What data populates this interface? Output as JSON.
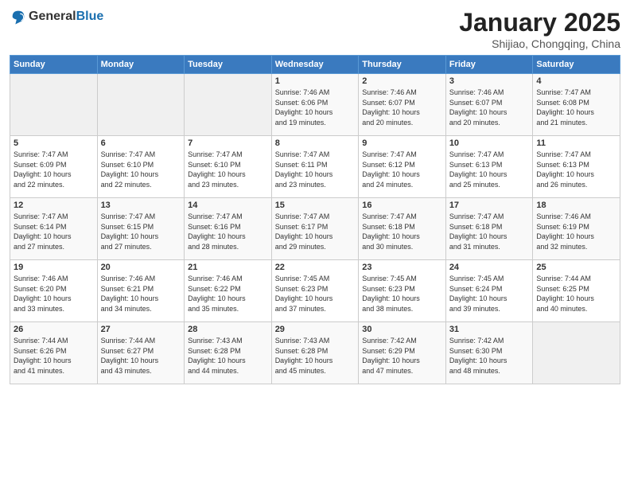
{
  "logo": {
    "general": "General",
    "blue": "Blue"
  },
  "header": {
    "title": "January 2025",
    "subtitle": "Shijiao, Chongqing, China"
  },
  "weekdays": [
    "Sunday",
    "Monday",
    "Tuesday",
    "Wednesday",
    "Thursday",
    "Friday",
    "Saturday"
  ],
  "weeks": [
    [
      {
        "day": "",
        "info": ""
      },
      {
        "day": "",
        "info": ""
      },
      {
        "day": "",
        "info": ""
      },
      {
        "day": "1",
        "info": "Sunrise: 7:46 AM\nSunset: 6:06 PM\nDaylight: 10 hours\nand 19 minutes."
      },
      {
        "day": "2",
        "info": "Sunrise: 7:46 AM\nSunset: 6:07 PM\nDaylight: 10 hours\nand 20 minutes."
      },
      {
        "day": "3",
        "info": "Sunrise: 7:46 AM\nSunset: 6:07 PM\nDaylight: 10 hours\nand 20 minutes."
      },
      {
        "day": "4",
        "info": "Sunrise: 7:47 AM\nSunset: 6:08 PM\nDaylight: 10 hours\nand 21 minutes."
      }
    ],
    [
      {
        "day": "5",
        "info": "Sunrise: 7:47 AM\nSunset: 6:09 PM\nDaylight: 10 hours\nand 22 minutes."
      },
      {
        "day": "6",
        "info": "Sunrise: 7:47 AM\nSunset: 6:10 PM\nDaylight: 10 hours\nand 22 minutes."
      },
      {
        "day": "7",
        "info": "Sunrise: 7:47 AM\nSunset: 6:10 PM\nDaylight: 10 hours\nand 23 minutes."
      },
      {
        "day": "8",
        "info": "Sunrise: 7:47 AM\nSunset: 6:11 PM\nDaylight: 10 hours\nand 23 minutes."
      },
      {
        "day": "9",
        "info": "Sunrise: 7:47 AM\nSunset: 6:12 PM\nDaylight: 10 hours\nand 24 minutes."
      },
      {
        "day": "10",
        "info": "Sunrise: 7:47 AM\nSunset: 6:13 PM\nDaylight: 10 hours\nand 25 minutes."
      },
      {
        "day": "11",
        "info": "Sunrise: 7:47 AM\nSunset: 6:13 PM\nDaylight: 10 hours\nand 26 minutes."
      }
    ],
    [
      {
        "day": "12",
        "info": "Sunrise: 7:47 AM\nSunset: 6:14 PM\nDaylight: 10 hours\nand 27 minutes."
      },
      {
        "day": "13",
        "info": "Sunrise: 7:47 AM\nSunset: 6:15 PM\nDaylight: 10 hours\nand 27 minutes."
      },
      {
        "day": "14",
        "info": "Sunrise: 7:47 AM\nSunset: 6:16 PM\nDaylight: 10 hours\nand 28 minutes."
      },
      {
        "day": "15",
        "info": "Sunrise: 7:47 AM\nSunset: 6:17 PM\nDaylight: 10 hours\nand 29 minutes."
      },
      {
        "day": "16",
        "info": "Sunrise: 7:47 AM\nSunset: 6:18 PM\nDaylight: 10 hours\nand 30 minutes."
      },
      {
        "day": "17",
        "info": "Sunrise: 7:47 AM\nSunset: 6:18 PM\nDaylight: 10 hours\nand 31 minutes."
      },
      {
        "day": "18",
        "info": "Sunrise: 7:46 AM\nSunset: 6:19 PM\nDaylight: 10 hours\nand 32 minutes."
      }
    ],
    [
      {
        "day": "19",
        "info": "Sunrise: 7:46 AM\nSunset: 6:20 PM\nDaylight: 10 hours\nand 33 minutes."
      },
      {
        "day": "20",
        "info": "Sunrise: 7:46 AM\nSunset: 6:21 PM\nDaylight: 10 hours\nand 34 minutes."
      },
      {
        "day": "21",
        "info": "Sunrise: 7:46 AM\nSunset: 6:22 PM\nDaylight: 10 hours\nand 35 minutes."
      },
      {
        "day": "22",
        "info": "Sunrise: 7:45 AM\nSunset: 6:23 PM\nDaylight: 10 hours\nand 37 minutes."
      },
      {
        "day": "23",
        "info": "Sunrise: 7:45 AM\nSunset: 6:23 PM\nDaylight: 10 hours\nand 38 minutes."
      },
      {
        "day": "24",
        "info": "Sunrise: 7:45 AM\nSunset: 6:24 PM\nDaylight: 10 hours\nand 39 minutes."
      },
      {
        "day": "25",
        "info": "Sunrise: 7:44 AM\nSunset: 6:25 PM\nDaylight: 10 hours\nand 40 minutes."
      }
    ],
    [
      {
        "day": "26",
        "info": "Sunrise: 7:44 AM\nSunset: 6:26 PM\nDaylight: 10 hours\nand 41 minutes."
      },
      {
        "day": "27",
        "info": "Sunrise: 7:44 AM\nSunset: 6:27 PM\nDaylight: 10 hours\nand 43 minutes."
      },
      {
        "day": "28",
        "info": "Sunrise: 7:43 AM\nSunset: 6:28 PM\nDaylight: 10 hours\nand 44 minutes."
      },
      {
        "day": "29",
        "info": "Sunrise: 7:43 AM\nSunset: 6:28 PM\nDaylight: 10 hours\nand 45 minutes."
      },
      {
        "day": "30",
        "info": "Sunrise: 7:42 AM\nSunset: 6:29 PM\nDaylight: 10 hours\nand 47 minutes."
      },
      {
        "day": "31",
        "info": "Sunrise: 7:42 AM\nSunset: 6:30 PM\nDaylight: 10 hours\nand 48 minutes."
      },
      {
        "day": "",
        "info": ""
      }
    ]
  ]
}
